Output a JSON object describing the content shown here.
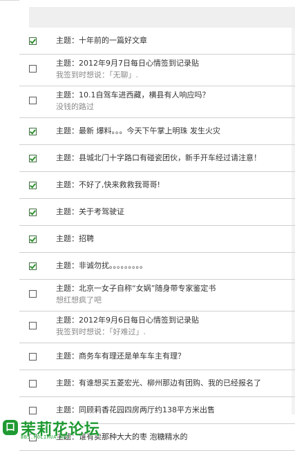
{
  "rows": [
    {
      "checked": true,
      "title": "主题：十年前的一篇好文章"
    },
    {
      "checked": false,
      "title": "主题：2012年9月7日每日心情签到记录贴",
      "sub": "我签到时想说：「无聊」."
    },
    {
      "checked": false,
      "title": "主题：10.1自驾车进西藏，横县有人响应吗？",
      "sub": "没钱的路过"
    },
    {
      "checked": true,
      "title": "主题：最新 爆料。。。今天下午掌上明珠 发生火灾"
    },
    {
      "checked": true,
      "title": "主题：县城北门十字路口有碰瓷团伙，新手开车经过请注意！"
    },
    {
      "checked": true,
      "title": "主题：不好了,快来救救我哥哥!"
    },
    {
      "checked": true,
      "title": "主题：关于考驾驶证"
    },
    {
      "checked": true,
      "title": "主题：招聘"
    },
    {
      "checked": true,
      "title": "主题：非诚勿扰。。。。。。。。。"
    },
    {
      "checked": false,
      "title": "主题：北京一女子自称“女娲”随身带专家鉴定书",
      "sub": "想红想疯了吧"
    },
    {
      "checked": false,
      "title": "主题：2012年9月6日每日心情签到记录贴",
      "sub": "我签到时想说：「好难过」."
    },
    {
      "checked": false,
      "title": "主题：商务车有理还是单车车主有理？"
    },
    {
      "checked": false,
      "title": "主题：有谁想买五菱宏光、柳州那边有团购、我的已经报名了"
    },
    {
      "checked": false,
      "title": "主题：同顾莉香花园四房两厅约138平方米出售"
    },
    {
      "checked": false,
      "title": "主题：谁有卖那种大大的枣 泡糖精水的"
    }
  ],
  "logo": {
    "title": "茉莉花论坛",
    "url": "BBS.MOLIHUA.NET",
    "glyph": "口"
  }
}
